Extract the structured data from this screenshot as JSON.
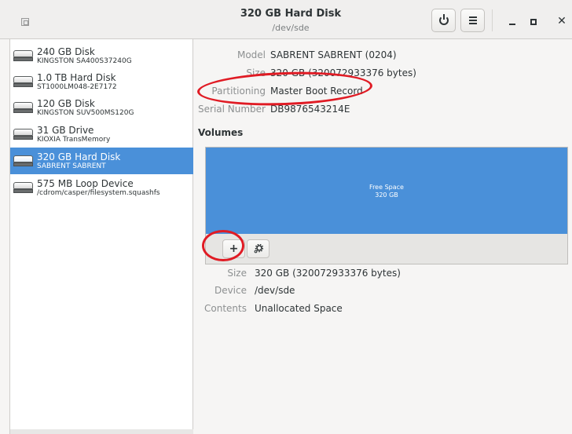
{
  "window": {
    "title": "320 GB Hard Disk",
    "subtitle": "/dev/sde",
    "close_glyph": "✕"
  },
  "icons": {
    "app": "disks-app-icon",
    "power": "power-icon",
    "menu": "hamburger-menu-icon",
    "minimize": "minimize-icon",
    "maximize": "maximize-icon",
    "close": "close-icon",
    "drive": "hard-drive-icon",
    "gear": "gear-icon",
    "add": "plus-icon"
  },
  "sidebar": {
    "drives": [
      {
        "name": "240 GB Disk",
        "model": "KINGSTON SA400S37240G",
        "selected": false
      },
      {
        "name": "1.0 TB Hard Disk",
        "model": "ST1000LM048-2E7172",
        "selected": false
      },
      {
        "name": "120 GB Disk",
        "model": "KINGSTON SUV500MS120G",
        "selected": false
      },
      {
        "name": "31 GB Drive",
        "model": "KIOXIA TransMemory",
        "selected": false
      },
      {
        "name": "320 GB Hard Disk",
        "model": "SABRENT SABRENT",
        "selected": true
      },
      {
        "name": "575 MB Loop Device",
        "model": "/cdrom/casper/filesystem.squashfs",
        "selected": false
      }
    ]
  },
  "disk_info": {
    "model_label": "Model",
    "model_value": "SABRENT SABRENT (0204)",
    "size_label": "Size",
    "size_value": "320 GB (320072933376 bytes)",
    "partitioning_label": "Partitioning",
    "partitioning_value": "Master Boot Record",
    "serial_label": "Serial Number",
    "serial_value": "DB9876543214E"
  },
  "volumes": {
    "heading": "Volumes",
    "segment_name": "Free Space",
    "segment_size": "320 GB",
    "add_label": "+",
    "size_label": "Size",
    "size_value": "320 GB (320072933376 bytes)",
    "device_label": "Device",
    "device_value": "/dev/sde",
    "contents_label": "Contents",
    "contents_value": "Unallocated Space"
  },
  "colors": {
    "selection": "#4a90d9",
    "annotation": "#e01b24"
  }
}
